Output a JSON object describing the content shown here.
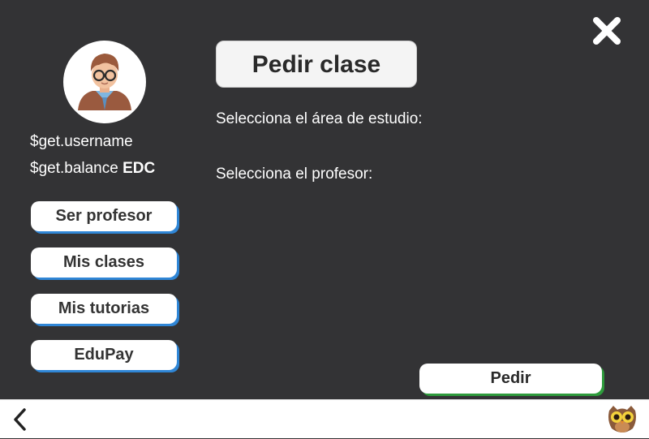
{
  "user": {
    "username": "$get.username",
    "balance": "$get.balance",
    "currency": "EDC"
  },
  "sidebar": {
    "items": [
      {
        "label": "Ser profesor"
      },
      {
        "label": "Mis clases"
      },
      {
        "label": "Mis tutorias"
      },
      {
        "label": "EduPay"
      }
    ]
  },
  "main": {
    "title": "Pedir clase",
    "area_prompt": "Selecciona el área de estudio:",
    "teacher_prompt": "Selecciona el profesor:",
    "submit_label": "Pedir"
  },
  "icons": {
    "close": "close-icon",
    "back": "chevron-left-icon",
    "mascot": "owl-icon",
    "avatar": "user-avatar"
  },
  "colors": {
    "background": "#333335",
    "sidebar_button_accent": "#2f86d6",
    "submit_button_accent": "#2e9b3c"
  }
}
